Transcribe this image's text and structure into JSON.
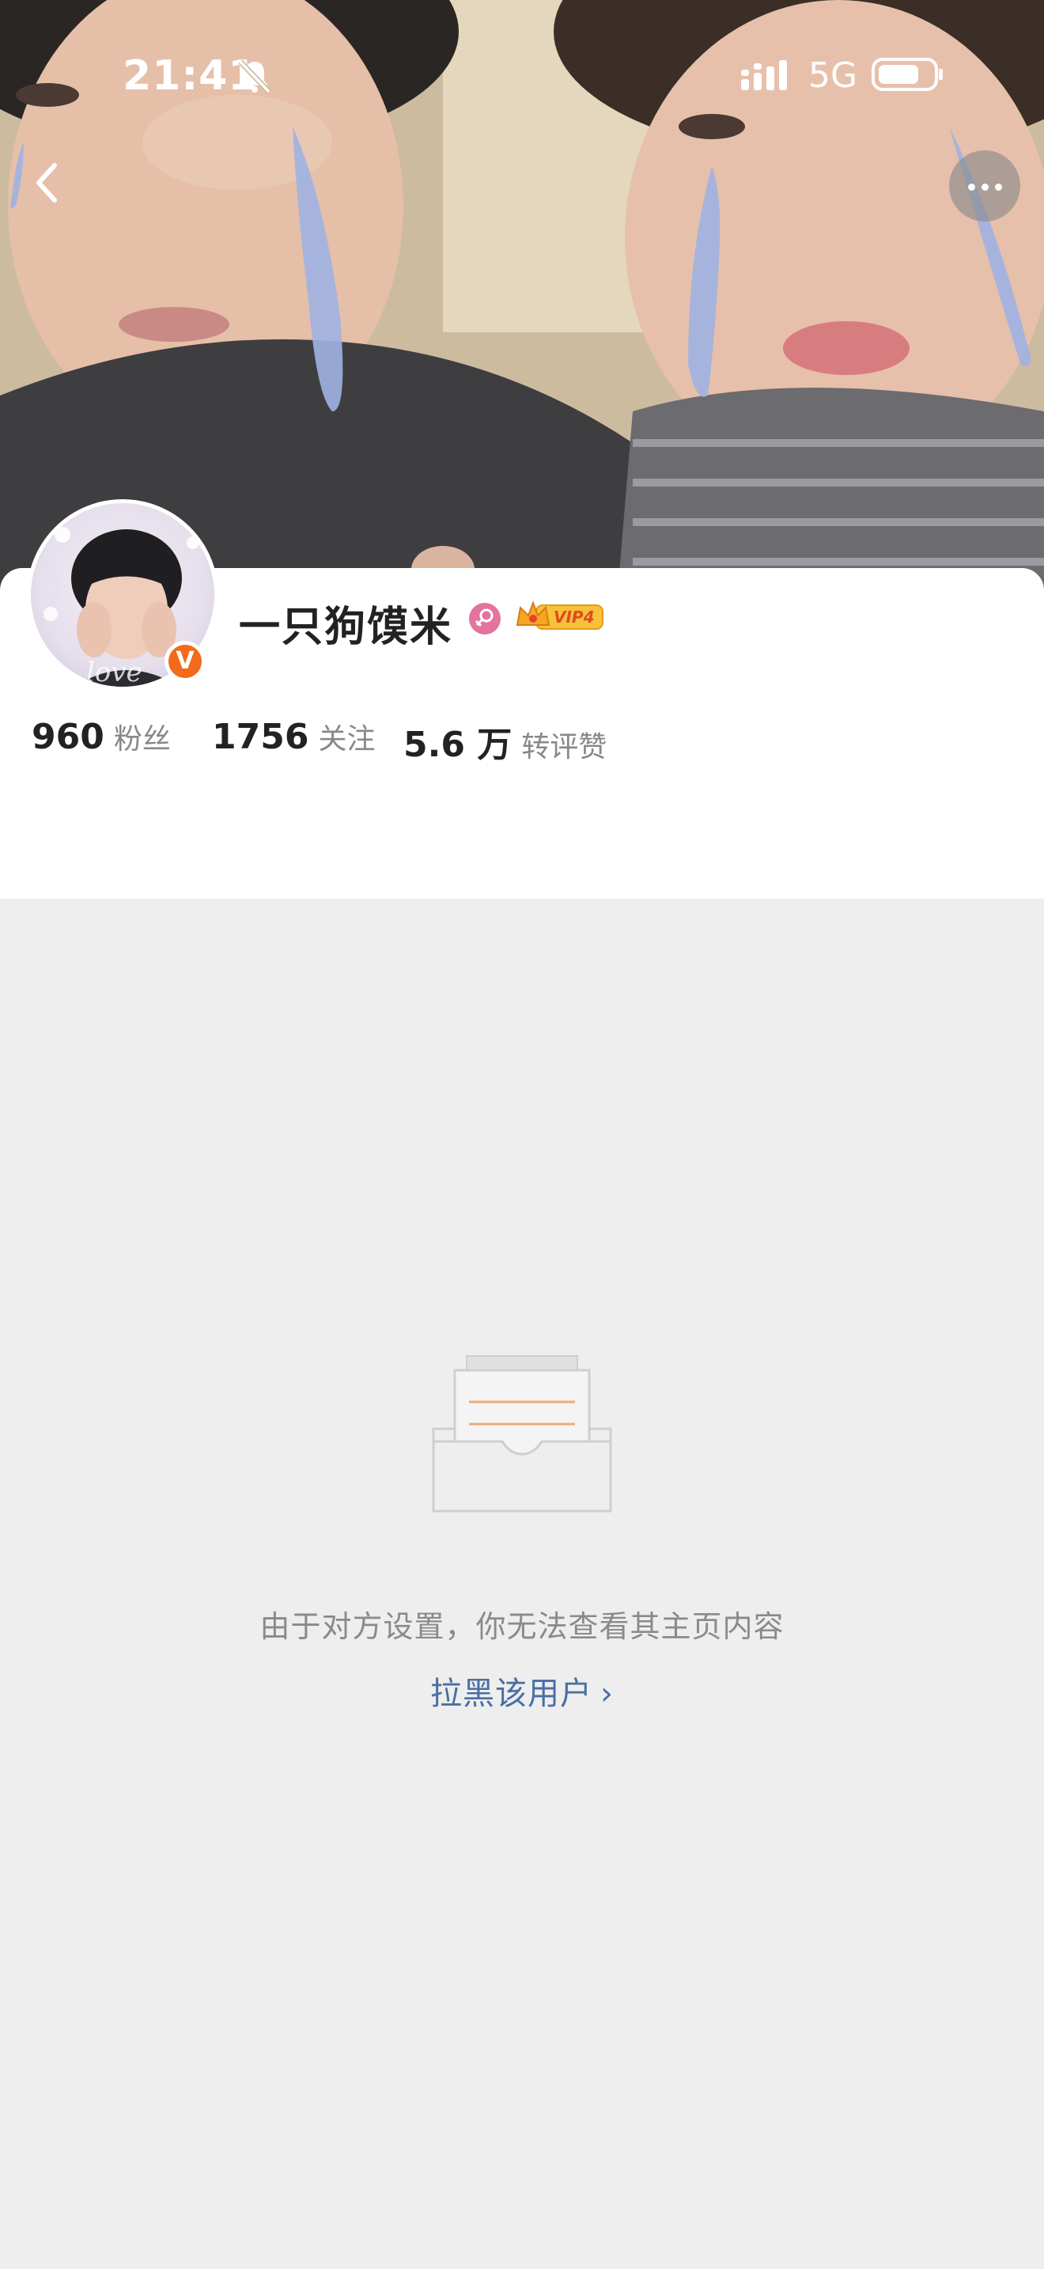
{
  "status_bar": {
    "time": "21:41",
    "network": "5G",
    "icons": [
      "bell-muted-icon",
      "signal-icon",
      "battery-icon"
    ]
  },
  "header": {
    "back_icon": "chevron-left-icon",
    "more_icon": "more-dots-icon"
  },
  "profile": {
    "name": "一只狗馍米",
    "gender_icon": "female-icon",
    "vip_label": "VIP4",
    "verified_label": "V",
    "stats": [
      {
        "value": "960",
        "label": "粉丝"
      },
      {
        "value": "1756",
        "label": "关注"
      },
      {
        "value": "5.6 万",
        "label": "转评赞"
      }
    ]
  },
  "empty_state": {
    "illustration_icon": "inbox-tray-icon",
    "message": "由于对方设置，你无法查看其主页内容",
    "action_label": "拉黑该用户",
    "action_chevron": "›"
  },
  "colors": {
    "page_background": "#eeeeee",
    "verified": "#f26a1b",
    "link": "#4a6ea3",
    "gender": "#e4739e"
  }
}
